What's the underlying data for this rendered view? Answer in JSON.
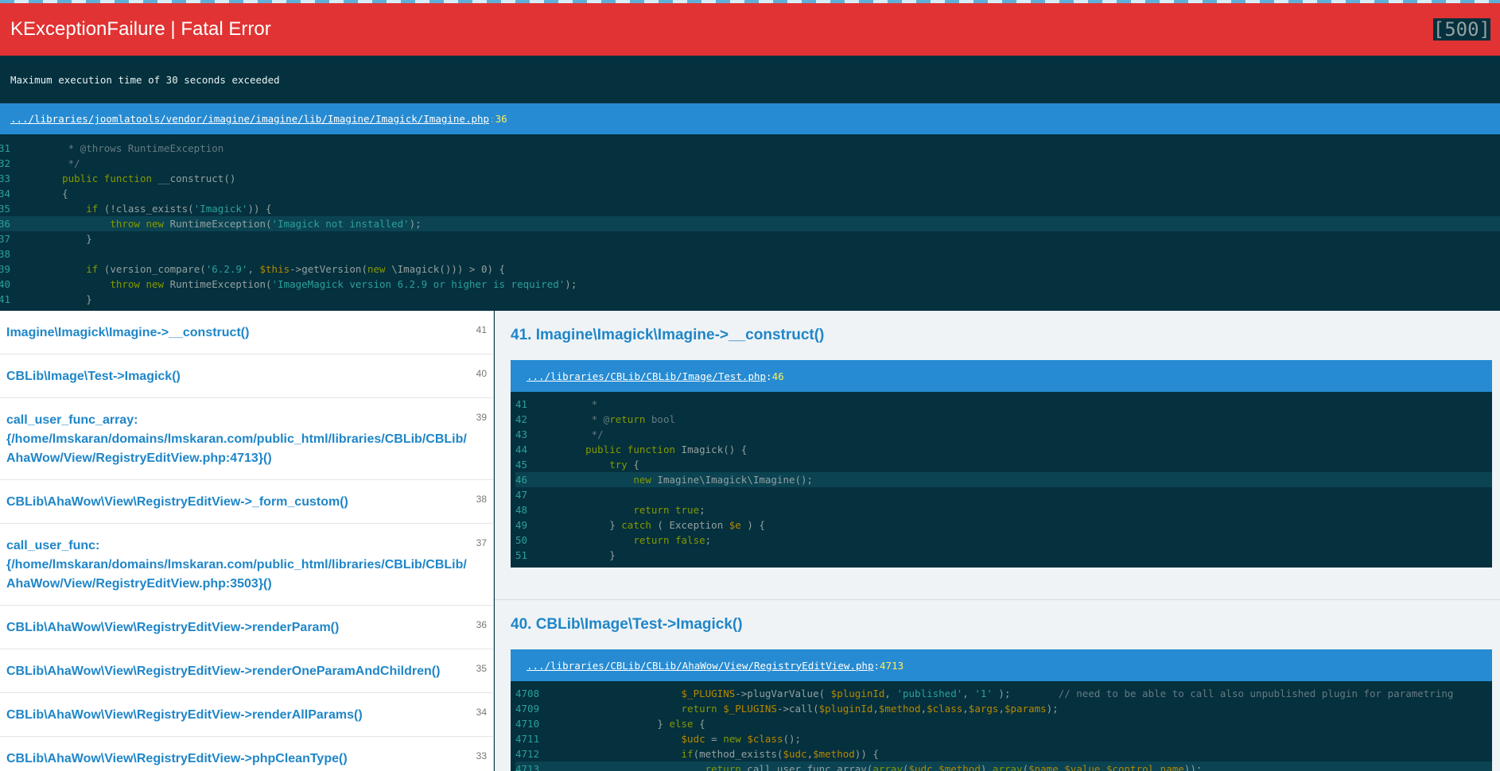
{
  "header": {
    "title": "KExceptionFailure | Fatal Error",
    "code": "[500]"
  },
  "message": "Maximum execution time of 30 seconds exceeded",
  "main": {
    "path": ".../libraries/joomlatools/vendor/imagine/imagine/lib/Imagine/Imagick/Imagine.php",
    "line": "36"
  },
  "main_code": {
    "lines": [
      {
        "n": "31",
        "text": "     * @throws RuntimeException"
      },
      {
        "n": "32",
        "text": "     */"
      },
      {
        "n": "33",
        "text": "    public function __construct()"
      },
      {
        "n": "34",
        "text": "    {"
      },
      {
        "n": "35",
        "text": "        if (!class_exists('Imagick')) {"
      },
      {
        "n": "36",
        "text": "            throw new RuntimeException('Imagick not installed');"
      },
      {
        "n": "37",
        "text": "        }"
      },
      {
        "n": "38",
        "text": ""
      },
      {
        "n": "39",
        "text": "        if (version_compare('6.2.9', $this->getVersion(new \\Imagick())) > 0) {"
      },
      {
        "n": "40",
        "text": "            throw new RuntimeException('ImageMagick version 6.2.9 or higher is required');"
      },
      {
        "n": "41",
        "text": "        }"
      }
    ]
  },
  "trace": [
    {
      "num": "41",
      "label": "Imagine\\Imagick\\Imagine->__construct()"
    },
    {
      "num": "40",
      "label": "CBLib\\Image\\Test->Imagick()"
    },
    {
      "num": "39",
      "label": "call_user_func_array:\n{/home/lmskaran/domains/lmskaran.com/public_html/libraries/CBLib/CBLib/AhaWow/View/RegistryEditView.php:4713}()"
    },
    {
      "num": "38",
      "label": "CBLib\\AhaWow\\View\\RegistryEditView->_form_custom()"
    },
    {
      "num": "37",
      "label": "call_user_func:\n{/home/lmskaran/domains/lmskaran.com/public_html/libraries/CBLib/CBLib/AhaWow/View/RegistryEditView.php:3503}()"
    },
    {
      "num": "36",
      "label": "CBLib\\AhaWow\\View\\RegistryEditView->renderParam()"
    },
    {
      "num": "35",
      "label": "CBLib\\AhaWow\\View\\RegistryEditView->renderOneParamAndChildren()"
    },
    {
      "num": "34",
      "label": "CBLib\\AhaWow\\View\\RegistryEditView->renderAllParams()"
    },
    {
      "num": "33",
      "label": "CBLib\\AhaWow\\View\\RegistryEditView->phpCleanType()"
    }
  ],
  "frames": [
    {
      "title": "41. Imagine\\Imagick\\Imagine->__construct()",
      "path": ".../libraries/CBLib/CBLib/Image/Test.php",
      "line": "46",
      "lines": [
        {
          "n": "41",
          "text": "\t *"
        },
        {
          "n": "42",
          "text": "\t * @return bool"
        },
        {
          "n": "43",
          "text": "\t */"
        },
        {
          "n": "44",
          "text": "\tpublic function Imagick() {"
        },
        {
          "n": "45",
          "text": "\t\ttry {"
        },
        {
          "n": "46",
          "text": "\t\t\tnew Imagine\\Imagick\\Imagine();"
        },
        {
          "n": "47",
          "text": ""
        },
        {
          "n": "48",
          "text": "\t\t\treturn true;"
        },
        {
          "n": "49",
          "text": "\t\t} catch ( Exception $e ) {"
        },
        {
          "n": "50",
          "text": "\t\t\treturn false;"
        },
        {
          "n": "51",
          "text": "\t\t}"
        }
      ]
    },
    {
      "title": "40. CBLib\\Image\\Test->Imagick()",
      "path": ".../libraries/CBLib/CBLib/AhaWow/View/RegistryEditView.php",
      "line": "4713",
      "lines": [
        {
          "n": "4708",
          "text": "\t\t\t\t\t$_PLUGINS->plugVarValue( $pluginId, 'published', '1' );\t\t// need to be able to call also unpublished plugin for parametring"
        },
        {
          "n": "4709",
          "text": "\t\t\t\t\treturn $_PLUGINS->call($pluginId,$method,$class,$args,$params);"
        },
        {
          "n": "4710",
          "text": "\t\t\t\t} else {"
        },
        {
          "n": "4711",
          "text": "\t\t\t\t\t$udc = new $class();"
        },
        {
          "n": "4712",
          "text": "\t\t\t\t\tif(method_exists($udc,$method)) {"
        },
        {
          "n": "4713",
          "text": "\t\t\t\t\t\treturn call_user_func_array(array($udc,$method),array($name,$value,$control_name));"
        }
      ]
    }
  ]
}
